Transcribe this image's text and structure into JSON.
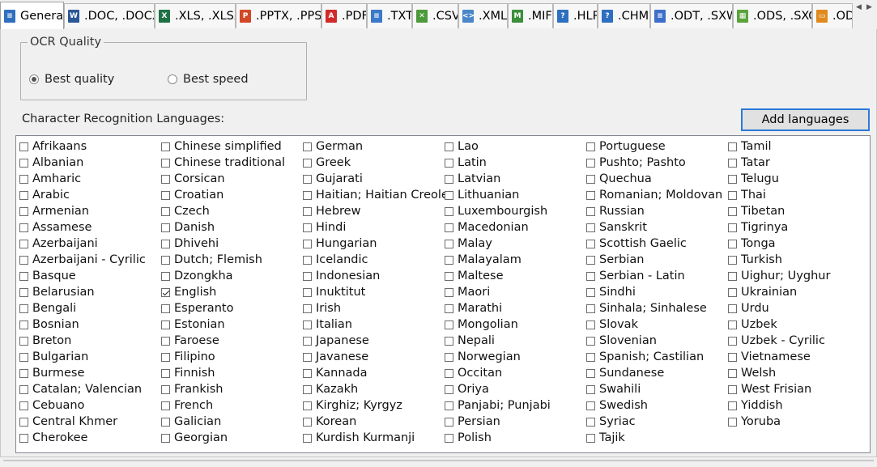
{
  "tabs": [
    {
      "label": "General",
      "icon": "general-doc-icon",
      "color": "#2f6fbf",
      "glyph": "≡"
    },
    {
      "label": ".DOC, .DOCX",
      "icon": "word-icon",
      "color": "#2b5797",
      "glyph": "W"
    },
    {
      "label": ".XLS, .XLSX",
      "icon": "excel-icon",
      "color": "#1e7145",
      "glyph": "X"
    },
    {
      "label": ".PPTX, .PPSX",
      "icon": "powerpoint-icon",
      "color": "#d24726",
      "glyph": "P"
    },
    {
      "label": ".PDF",
      "icon": "pdf-icon",
      "color": "#d02b2b",
      "glyph": "A"
    },
    {
      "label": ".TXT",
      "icon": "txt-icon",
      "color": "#3a78c8",
      "glyph": "≡"
    },
    {
      "label": ".CSV",
      "icon": "csv-icon",
      "color": "#4c9a3a",
      "glyph": "✕"
    },
    {
      "label": ".XML",
      "icon": "xml-icon",
      "color": "#4a86c8",
      "glyph": "<>"
    },
    {
      "label": ".MIF",
      "icon": "mif-icon",
      "color": "#3c8f3c",
      "glyph": "M"
    },
    {
      "label": ".HLP",
      "icon": "hlp-icon",
      "color": "#2d6fc0",
      "glyph": "?"
    },
    {
      "label": ".CHM",
      "icon": "chm-icon",
      "color": "#2d6fc0",
      "glyph": "?"
    },
    {
      "label": ".ODT, .SXW",
      "icon": "odt-icon",
      "color": "#3d6ec9",
      "glyph": "≡"
    },
    {
      "label": ".ODS, .SXC",
      "icon": "ods-icon",
      "color": "#5aa43a",
      "glyph": "▦"
    },
    {
      "label": ".OD",
      "icon": "odp-icon",
      "color": "#e08a1e",
      "glyph": "▭"
    }
  ],
  "ocr": {
    "title": "OCR Quality",
    "options": [
      {
        "label": "Best quality",
        "selected": true
      },
      {
        "label": "Best speed",
        "selected": false
      }
    ]
  },
  "languages_label": "Character Recognition Languages:",
  "add_languages_label": "Add languages",
  "languages": [
    [
      "Afrikaans",
      "Albanian",
      "Amharic",
      "Arabic",
      "Armenian",
      "Assamese",
      "Azerbaijani",
      "Azerbaijani - Cyrilic",
      "Basque",
      "Belarusian",
      "Bengali",
      "Bosnian",
      "Breton",
      "Bulgarian",
      "Burmese",
      "Catalan; Valencian",
      "Cebuano",
      "Central Khmer",
      "Cherokee"
    ],
    [
      "Chinese simplified",
      "Chinese traditional",
      "Corsican",
      "Croatian",
      "Czech",
      "Danish",
      "Dhivehi",
      "Dutch; Flemish",
      "Dzongkha",
      "English",
      "Esperanto",
      "Estonian",
      "Faroese",
      "Filipino",
      "Finnish",
      "Frankish",
      "French",
      "Galician",
      "Georgian"
    ],
    [
      "German",
      "Greek",
      "Gujarati",
      "Haitian; Haitian Creole",
      "Hebrew",
      "Hindi",
      "Hungarian",
      "Icelandic",
      "Indonesian",
      "Inuktitut",
      "Irish",
      "Italian",
      "Japanese",
      "Javanese",
      "Kannada",
      "Kazakh",
      "Kirghiz; Kyrgyz",
      "Korean",
      "Kurdish Kurmanji"
    ],
    [
      "Lao",
      "Latin",
      "Latvian",
      "Lithuanian",
      "Luxembourgish",
      "Macedonian",
      "Malay",
      "Malayalam",
      "Maltese",
      "Maori",
      "Marathi",
      "Mongolian",
      "Nepali",
      "Norwegian",
      "Occitan",
      "Oriya",
      "Panjabi; Punjabi",
      "Persian",
      "Polish"
    ],
    [
      "Portuguese",
      "Pushto; Pashto",
      "Quechua",
      "Romanian; Moldovan",
      "Russian",
      "Sanskrit",
      "Scottish Gaelic",
      "Serbian",
      "Serbian - Latin",
      "Sindhi",
      "Sinhala; Sinhalese",
      "Slovak",
      "Slovenian",
      "Spanish; Castilian",
      "Sundanese",
      "Swahili",
      "Swedish",
      "Syriac",
      "Tajik"
    ],
    [
      "Tamil",
      "Tatar",
      "Telugu",
      "Thai",
      "Tibetan",
      "Tigrinya",
      "Tonga",
      "Turkish",
      "Uighur; Uyghur",
      "Ukrainian",
      "Urdu",
      "Uzbek",
      "Uzbek - Cyrilic",
      "Vietnamese",
      "Welsh",
      "West Frisian",
      "Yiddish",
      "Yoruba"
    ]
  ],
  "checked": [
    "English"
  ]
}
